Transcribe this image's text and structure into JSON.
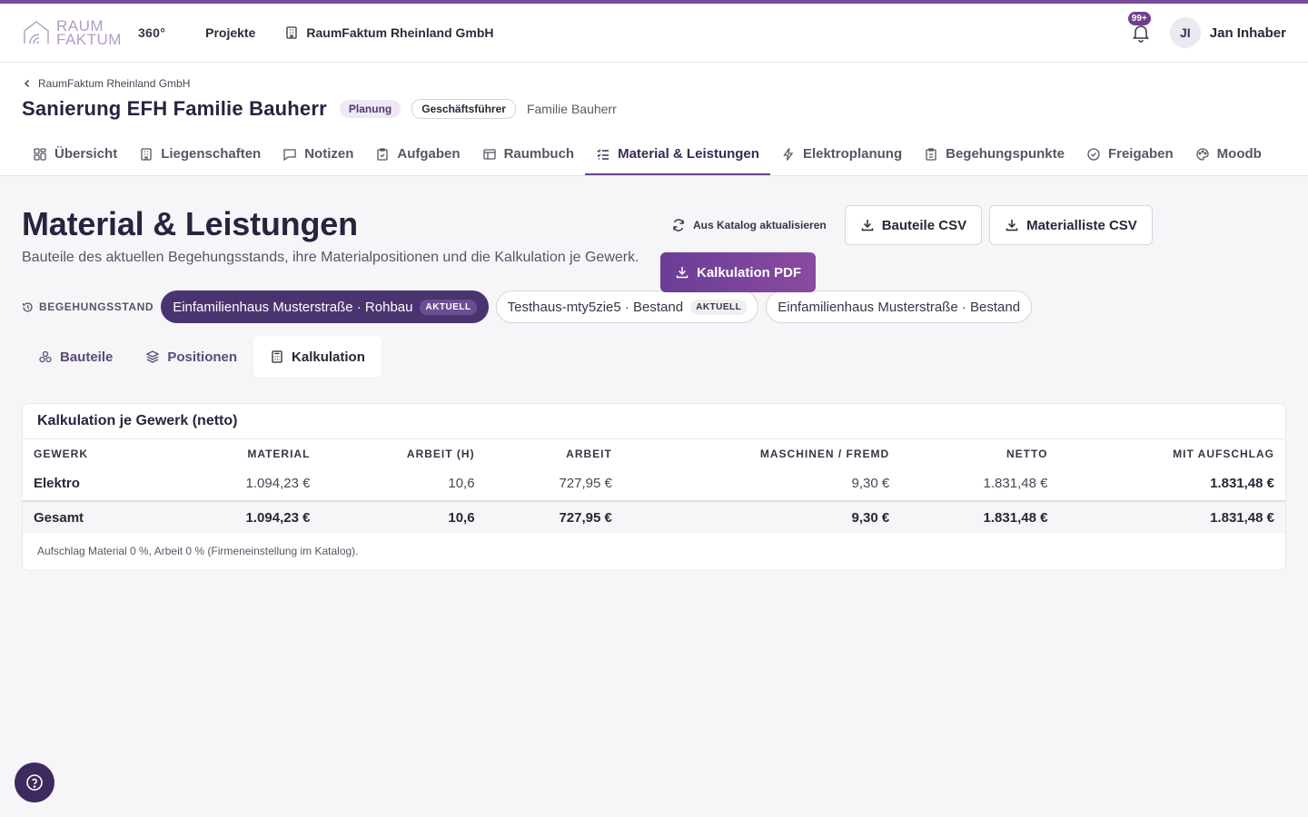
{
  "header": {
    "logo_line1": "RAUM",
    "logo_line2": "FAKTUM",
    "logo_suffix": "360°",
    "nav_projects": "Projekte",
    "nav_company": "RaumFaktum Rheinland GmbH",
    "notif_badge": "99+",
    "avatar_initials": "JI",
    "user_name": "Jan Inhaber"
  },
  "project": {
    "breadcrumb": "RaumFaktum Rheinland GmbH",
    "title": "Sanierung EFH Familie Bauherr",
    "status": "Planung",
    "role": "Geschäftsführer",
    "client": "Familie Bauherr"
  },
  "tabs": [
    {
      "label": "Übersicht",
      "icon": "grid-icon"
    },
    {
      "label": "Liegenschaften",
      "icon": "building-icon"
    },
    {
      "label": "Notizen",
      "icon": "message-icon"
    },
    {
      "label": "Aufgaben",
      "icon": "clipboard-check-icon"
    },
    {
      "label": "Raumbuch",
      "icon": "table-icon"
    },
    {
      "label": "Material & Leistungen",
      "icon": "list-check-icon",
      "active": true
    },
    {
      "label": "Elektroplanung",
      "icon": "bolt-icon"
    },
    {
      "label": "Begehungspunkte",
      "icon": "clipboard-list-icon"
    },
    {
      "label": "Freigaben",
      "icon": "check-circle-icon"
    },
    {
      "label": "Moodb",
      "icon": "palette-icon"
    }
  ],
  "page": {
    "title": "Material & Leistungen",
    "description": "Bauteile des aktuellen Begehungsstands, ihre Materialpositionen und die Kalkulation je Gewerk.",
    "btn_catalog": "Aus Katalog aktualisieren",
    "btn_bauteile_csv": "Bauteile CSV",
    "btn_material_csv": "Materialliste CSV",
    "btn_pdf": "Kalkulation PDF"
  },
  "stand": {
    "label": "BEGEHUNGSSTAND",
    "chips": [
      {
        "label": "Einfamilienhaus Musterstraße · Rohbau",
        "tag": "AKTUELL",
        "active": true
      },
      {
        "label": "Testhaus-mty5zie5 · Bestand",
        "tag": "AKTUELL",
        "active": false
      },
      {
        "label": "Einfamilienhaus Musterstraße · Bestand",
        "tag": "",
        "active": false
      }
    ]
  },
  "subtabs": {
    "bauteile": "Bauteile",
    "positionen": "Positionen",
    "kalkulation": "Kalkulation"
  },
  "table": {
    "title": "Kalkulation je Gewerk (netto)",
    "columns": [
      "GEWERK",
      "MATERIAL",
      "ARBEIT (H)",
      "ARBEIT",
      "MASCHINEN / FREMD",
      "NETTO",
      "MIT AUFSCHLAG"
    ],
    "rows": [
      [
        "Elektro",
        "1.094,23 €",
        "10,6",
        "727,95 €",
        "9,30 €",
        "1.831,48 €",
        "1.831,48 €"
      ]
    ],
    "total": [
      "Gesamt",
      "1.094,23 €",
      "10,6",
      "727,95 €",
      "9,30 €",
      "1.831,48 €",
      "1.831,48 €"
    ],
    "note": "Aufschlag Material 0 %, Arbeit 0 % (Firmeneinstellung im Katalog)."
  },
  "colors": {
    "accent": "#6f3f8d",
    "primary_dark": "#4a3470"
  }
}
